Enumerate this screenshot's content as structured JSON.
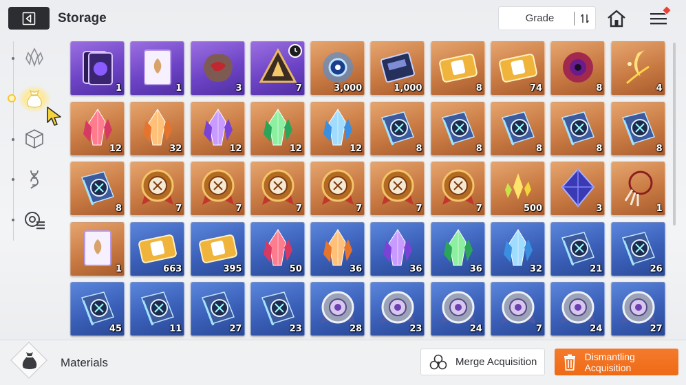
{
  "header": {
    "title": "Storage",
    "grade_label": "Grade"
  },
  "bottom": {
    "category_label": "Materials",
    "merge_label": "Merge Acquisition",
    "dismantle_label": "Dismantling Acquisition"
  },
  "colors": {
    "purple": "#6d43c6",
    "orange": "#c97a43",
    "blue": "#3a5fb8",
    "accent": "#ee6a16"
  },
  "sidebar": {
    "items": [
      {
        "icon": "crystal-icon"
      },
      {
        "icon": "material-bag-icon",
        "active": true
      },
      {
        "icon": "cube-icon"
      },
      {
        "icon": "dna-icon"
      },
      {
        "icon": "gear-list-icon"
      }
    ]
  },
  "items": [
    {
      "grade": "purple",
      "icon": "card-pack-icon",
      "qty": "1"
    },
    {
      "grade": "purple",
      "icon": "manual-icon",
      "qty": "1"
    },
    {
      "grade": "purple",
      "icon": "ore-icon",
      "qty": "3"
    },
    {
      "grade": "purple",
      "icon": "pyramid-icon",
      "qty": "7",
      "timer": true
    },
    {
      "grade": "orange",
      "icon": "blue-orb-icon",
      "qty": "3,000"
    },
    {
      "grade": "orange",
      "icon": "chip-icon",
      "qty": "1,000"
    },
    {
      "grade": "orange",
      "icon": "ticket-icon",
      "qty": "8"
    },
    {
      "grade": "orange",
      "icon": "ticket-icon",
      "qty": "74"
    },
    {
      "grade": "orange",
      "icon": "eye-orb-icon",
      "qty": "8"
    },
    {
      "grade": "orange",
      "icon": "moon-feather-icon",
      "qty": "4"
    },
    {
      "grade": "orange",
      "icon": "red-crystal-icon",
      "qty": "12"
    },
    {
      "grade": "orange",
      "icon": "orange-crystal-icon",
      "qty": "32"
    },
    {
      "grade": "orange",
      "icon": "purple-crystal-icon",
      "qty": "12"
    },
    {
      "grade": "orange",
      "icon": "green-crystal-icon",
      "qty": "12"
    },
    {
      "grade": "orange",
      "icon": "blue-crystal-icon",
      "qty": "12"
    },
    {
      "grade": "orange",
      "icon": "skill-book-icon",
      "qty": "8"
    },
    {
      "grade": "orange",
      "icon": "skill-book-icon",
      "qty": "8"
    },
    {
      "grade": "orange",
      "icon": "skill-book-icon",
      "qty": "8"
    },
    {
      "grade": "orange",
      "icon": "skill-book-icon",
      "qty": "8"
    },
    {
      "grade": "orange",
      "icon": "skill-book-icon",
      "qty": "8"
    },
    {
      "grade": "orange",
      "icon": "skill-book-icon",
      "qty": "8"
    },
    {
      "grade": "orange",
      "icon": "medal-icon",
      "qty": "7"
    },
    {
      "grade": "orange",
      "icon": "medal-icon",
      "qty": "7"
    },
    {
      "grade": "orange",
      "icon": "medal-icon",
      "qty": "7"
    },
    {
      "grade": "orange",
      "icon": "medal-icon",
      "qty": "7"
    },
    {
      "grade": "orange",
      "icon": "medal-icon",
      "qty": "7"
    },
    {
      "grade": "orange",
      "icon": "medal-icon",
      "qty": "7"
    },
    {
      "grade": "orange",
      "icon": "yellow-shard-icon",
      "qty": "500"
    },
    {
      "grade": "orange",
      "icon": "octahedron-icon",
      "qty": "3"
    },
    {
      "grade": "orange",
      "icon": "dreamcatcher-icon",
      "qty": "1"
    },
    {
      "grade": "orange",
      "icon": "manual-icon",
      "qty": "1"
    },
    {
      "grade": "blue",
      "icon": "ticket-icon",
      "qty": "663"
    },
    {
      "grade": "blue",
      "icon": "ticket-icon",
      "qty": "395"
    },
    {
      "grade": "blue",
      "icon": "red-crystal-icon",
      "qty": "50"
    },
    {
      "grade": "blue",
      "icon": "orange-crystal-icon",
      "qty": "36"
    },
    {
      "grade": "blue",
      "icon": "purple-crystal-icon",
      "qty": "36"
    },
    {
      "grade": "blue",
      "icon": "green-crystal-icon",
      "qty": "36"
    },
    {
      "grade": "blue",
      "icon": "blue-crystal-icon",
      "qty": "32"
    },
    {
      "grade": "blue",
      "icon": "skill-book-icon",
      "qty": "21"
    },
    {
      "grade": "blue",
      "icon": "skill-book-icon",
      "qty": "26"
    },
    {
      "grade": "blue",
      "icon": "skill-book-icon",
      "qty": "45"
    },
    {
      "grade": "blue",
      "icon": "skill-book-icon",
      "qty": "11"
    },
    {
      "grade": "blue",
      "icon": "skill-book-icon",
      "qty": "27"
    },
    {
      "grade": "blue",
      "icon": "skill-book-icon",
      "qty": "23"
    },
    {
      "grade": "blue",
      "icon": "silver-medal-icon",
      "qty": "28"
    },
    {
      "grade": "blue",
      "icon": "silver-medal-icon",
      "qty": "23"
    },
    {
      "grade": "blue",
      "icon": "silver-medal-icon",
      "qty": "24"
    },
    {
      "grade": "blue",
      "icon": "silver-medal-icon",
      "qty": "7"
    },
    {
      "grade": "blue",
      "icon": "silver-medal-icon",
      "qty": "24"
    },
    {
      "grade": "blue",
      "icon": "silver-medal-icon",
      "qty": "27"
    }
  ]
}
